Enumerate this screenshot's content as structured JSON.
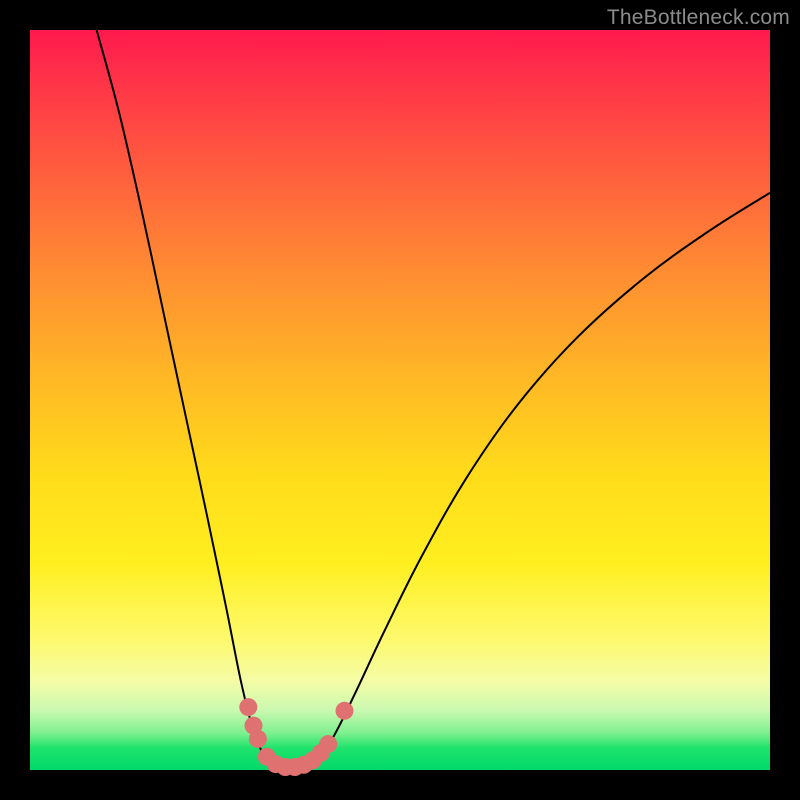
{
  "watermark": "TheBottleneck.com",
  "chart_data": {
    "type": "line",
    "title": "",
    "xlabel": "",
    "ylabel": "",
    "xlim": [
      0,
      100
    ],
    "ylim": [
      0,
      100
    ],
    "grid": false,
    "curve_points": [
      {
        "x": 9.0,
        "y": 100.0
      },
      {
        "x": 12.0,
        "y": 89.0
      },
      {
        "x": 15.0,
        "y": 76.0
      },
      {
        "x": 18.0,
        "y": 62.0
      },
      {
        "x": 21.0,
        "y": 48.0
      },
      {
        "x": 24.0,
        "y": 34.0
      },
      {
        "x": 26.5,
        "y": 22.0
      },
      {
        "x": 28.5,
        "y": 12.0
      },
      {
        "x": 30.0,
        "y": 6.0
      },
      {
        "x": 31.5,
        "y": 2.2
      },
      {
        "x": 33.0,
        "y": 0.7
      },
      {
        "x": 35.0,
        "y": 0.2
      },
      {
        "x": 37.0,
        "y": 0.5
      },
      {
        "x": 39.0,
        "y": 1.8
      },
      {
        "x": 41.0,
        "y": 4.5
      },
      {
        "x": 44.0,
        "y": 10.5
      },
      {
        "x": 48.0,
        "y": 19.0
      },
      {
        "x": 53.0,
        "y": 29.0
      },
      {
        "x": 59.0,
        "y": 39.5
      },
      {
        "x": 66.0,
        "y": 49.5
      },
      {
        "x": 74.0,
        "y": 58.5
      },
      {
        "x": 83.0,
        "y": 66.5
      },
      {
        "x": 92.0,
        "y": 73.0
      },
      {
        "x": 100.0,
        "y": 78.0
      }
    ],
    "markers": [
      {
        "x": 29.5,
        "y": 8.5
      },
      {
        "x": 30.2,
        "y": 6.0
      },
      {
        "x": 30.8,
        "y": 4.2
      },
      {
        "x": 32.0,
        "y": 1.8
      },
      {
        "x": 33.2,
        "y": 0.8
      },
      {
        "x": 34.5,
        "y": 0.4
      },
      {
        "x": 35.8,
        "y": 0.4
      },
      {
        "x": 37.0,
        "y": 0.7
      },
      {
        "x": 38.2,
        "y": 1.3
      },
      {
        "x": 39.3,
        "y": 2.3
      },
      {
        "x": 40.3,
        "y": 3.5
      },
      {
        "x": 42.5,
        "y": 8.0
      }
    ],
    "gradient_description": "vertical thermal gradient (red at top through orange/yellow to green at bottom) representing bottleneck severity; black V-shaped curve dips to minimum near x≈35"
  }
}
